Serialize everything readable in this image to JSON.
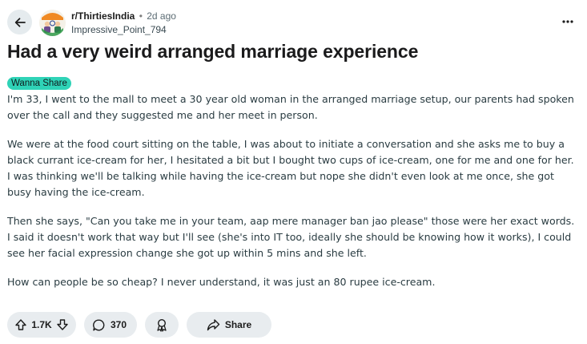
{
  "post": {
    "subreddit": "r/ThirtiesIndia",
    "separator": "•",
    "age": "2d ago",
    "author": "Impressive_Point_794",
    "title": "Had a very weird arranged marriage experience",
    "flair": "Wanna Share",
    "flair_color": "#2fd3b7",
    "paragraphs": [
      "I'm 33, I went to the mall to meet a 30 year old woman in the arranged marriage setup, our parents had spoken over the call and they suggested me and her meet in person.",
      "We were at the food court sitting on the table, I was about to initiate a conversation and she asks me to buy a black currant ice-cream for her, I hesitated a bit but I bought two cups of ice-cream, one for me and one for her. I was thinking we'll be talking while having the ice-cream but nope she didn't even look at me once, she got busy having the ice-cream.",
      "Then she says, \"Can you take me in your team, aap mere manager ban jao please\" those were her exact words. I said it doesn't work that way but I'll see (she's into IT too, ideally she should be knowing how it works), I could see her facial expression change she got up within 5 mins and she left.",
      "How can people be so cheap? I never understand, it was just an 80 rupee ice-cream."
    ]
  },
  "actions": {
    "votes": "1.7K",
    "comments": "370",
    "share_label": "Share"
  },
  "icons": {
    "back": "arrow-left-icon",
    "more": "ellipsis-icon",
    "upvote": "arrow-up-icon",
    "downvote": "arrow-down-icon",
    "comment": "speech-bubble-icon",
    "award": "award-ribbon-icon",
    "share": "share-arrow-icon"
  }
}
